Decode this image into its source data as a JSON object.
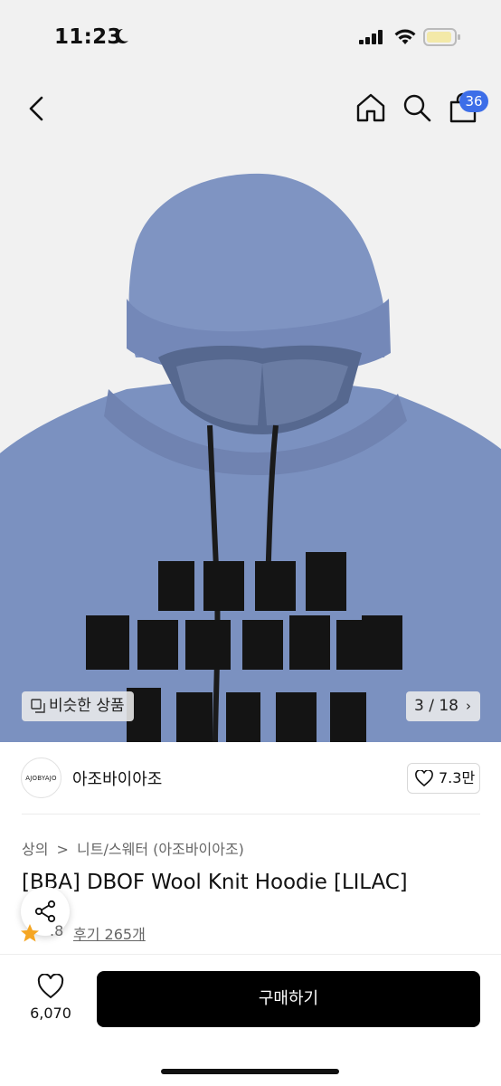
{
  "status_bar": {
    "time": "11:23"
  },
  "nav": {
    "cart_count": "36"
  },
  "gallery": {
    "similar_label": "비슷한 상품",
    "page_indicator": "3 / 18",
    "page_chevron": "›"
  },
  "brand": {
    "logo_text": "AJOBYAJO",
    "name": "아조바이아조",
    "likes": "7.3만"
  },
  "breadcrumb": {
    "level1": "상의",
    "separator": ">",
    "level2": "니트/스웨터 (아조바이아조)"
  },
  "product": {
    "title": "[BBA] DBOF Wool Knit Hoodie [LILAC]",
    "rating": ".8",
    "review_label": "후기 265개"
  },
  "bottom_bar": {
    "like_count": "6,070",
    "buy_label": "구매하기"
  },
  "colors": {
    "hoodie": "#7b91c0",
    "accent_badge": "#3d6ee8",
    "button": "#000000",
    "star": "#f5a623"
  }
}
